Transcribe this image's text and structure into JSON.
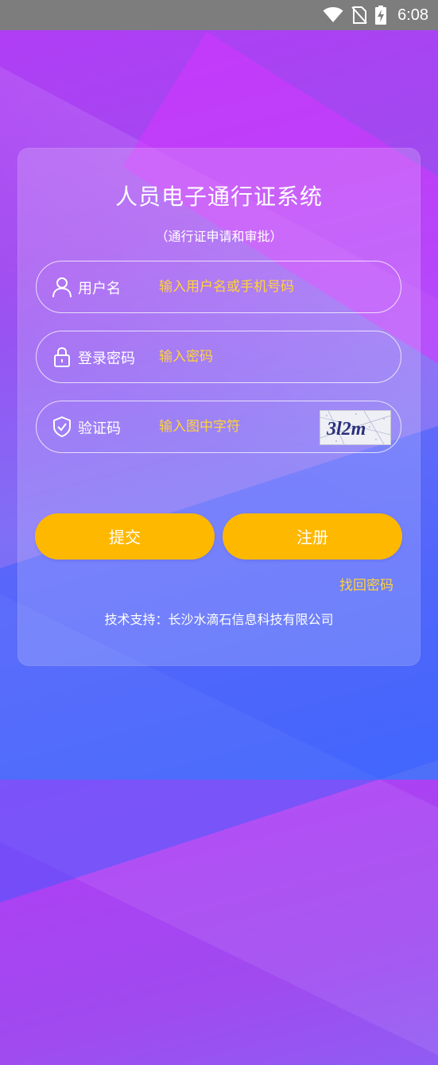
{
  "status_bar": {
    "time": "6:08",
    "icons": [
      "wifi-icon",
      "no-sim-icon",
      "battery-charging-icon"
    ]
  },
  "login": {
    "title": "人员电子通行证系统",
    "subtitle": "（通行证申请和审批）",
    "username": {
      "icon": "user-icon",
      "label": "用户名",
      "placeholder": "输入用户名或手机号码",
      "value": ""
    },
    "password": {
      "icon": "lock-icon",
      "label": "登录密码",
      "placeholder": "输入密码",
      "value": ""
    },
    "captcha": {
      "icon": "shield-check-icon",
      "label": "验证码",
      "placeholder": "输入图中字符",
      "value": "",
      "image_text": "3l2m"
    },
    "submit_label": "提交",
    "register_label": "注册",
    "forgot_label": "找回密码",
    "support_text": "技术支持：长沙水滴石信息科技有限公司"
  },
  "colors": {
    "accent": "#ffb800",
    "placeholder": "#ffd33a",
    "status_bar": "#7d7d7d",
    "gradient_top": "#b23cf5",
    "gradient_bottom": "#4d6ff9"
  }
}
